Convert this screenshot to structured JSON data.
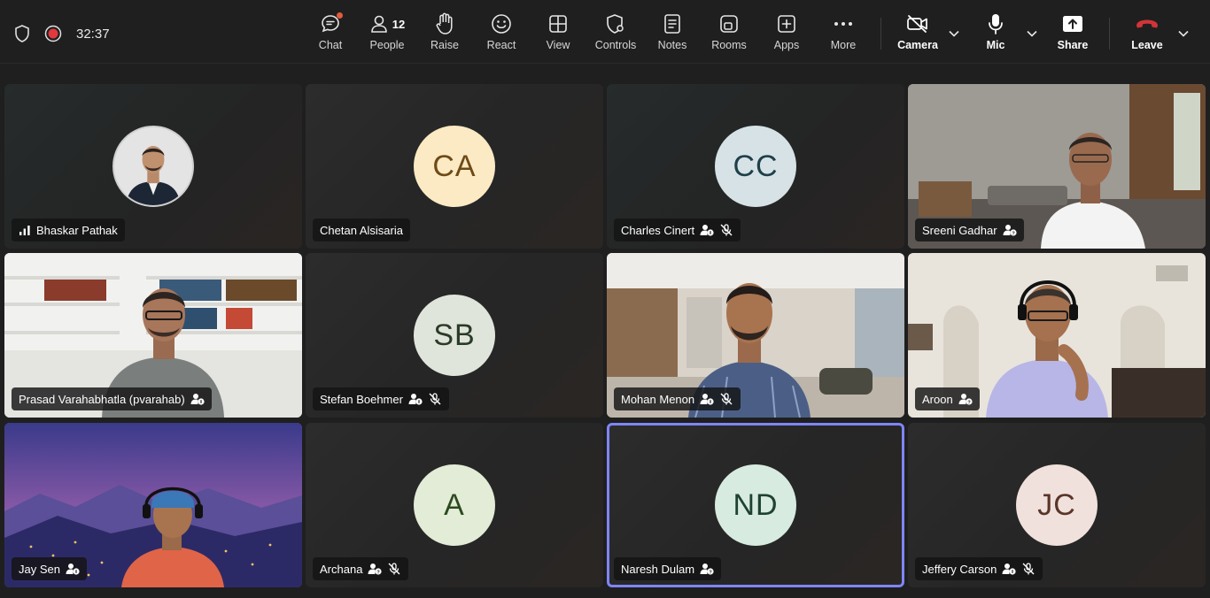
{
  "toolbar": {
    "timer": "32:37",
    "chat_label": "Chat",
    "people_label": "People",
    "people_count": "12",
    "raise_label": "Raise",
    "react_label": "React",
    "view_label": "View",
    "controls_label": "Controls",
    "notes_label": "Notes",
    "rooms_label": "Rooms",
    "apps_label": "Apps",
    "more_label": "More",
    "camera_label": "Camera",
    "mic_label": "Mic",
    "share_label": "Share",
    "leave_label": "Leave"
  },
  "participants": [
    {
      "name": "Bhaskar Pathak"
    },
    {
      "name": "Chetan Alsisaria",
      "initials": "CA"
    },
    {
      "name": "Charles Cinert",
      "initials": "CC"
    },
    {
      "name": "Sreeni Gadhar"
    },
    {
      "name": "Prasad Varahabhatla (pvarahab)"
    },
    {
      "name": "Stefan Boehmer",
      "initials": "SB"
    },
    {
      "name": "Mohan Menon"
    },
    {
      "name": "Aroon"
    },
    {
      "name": "Jay Sen"
    },
    {
      "name": "Archana",
      "initials": "A"
    },
    {
      "name": "Naresh Dulam",
      "initials": "ND"
    },
    {
      "name": "Jeffery Carson",
      "initials": "JC"
    }
  ],
  "colors": {
    "active_border": "#7f85f5",
    "record_red": "#e0393e",
    "leave_red": "#d13438"
  }
}
